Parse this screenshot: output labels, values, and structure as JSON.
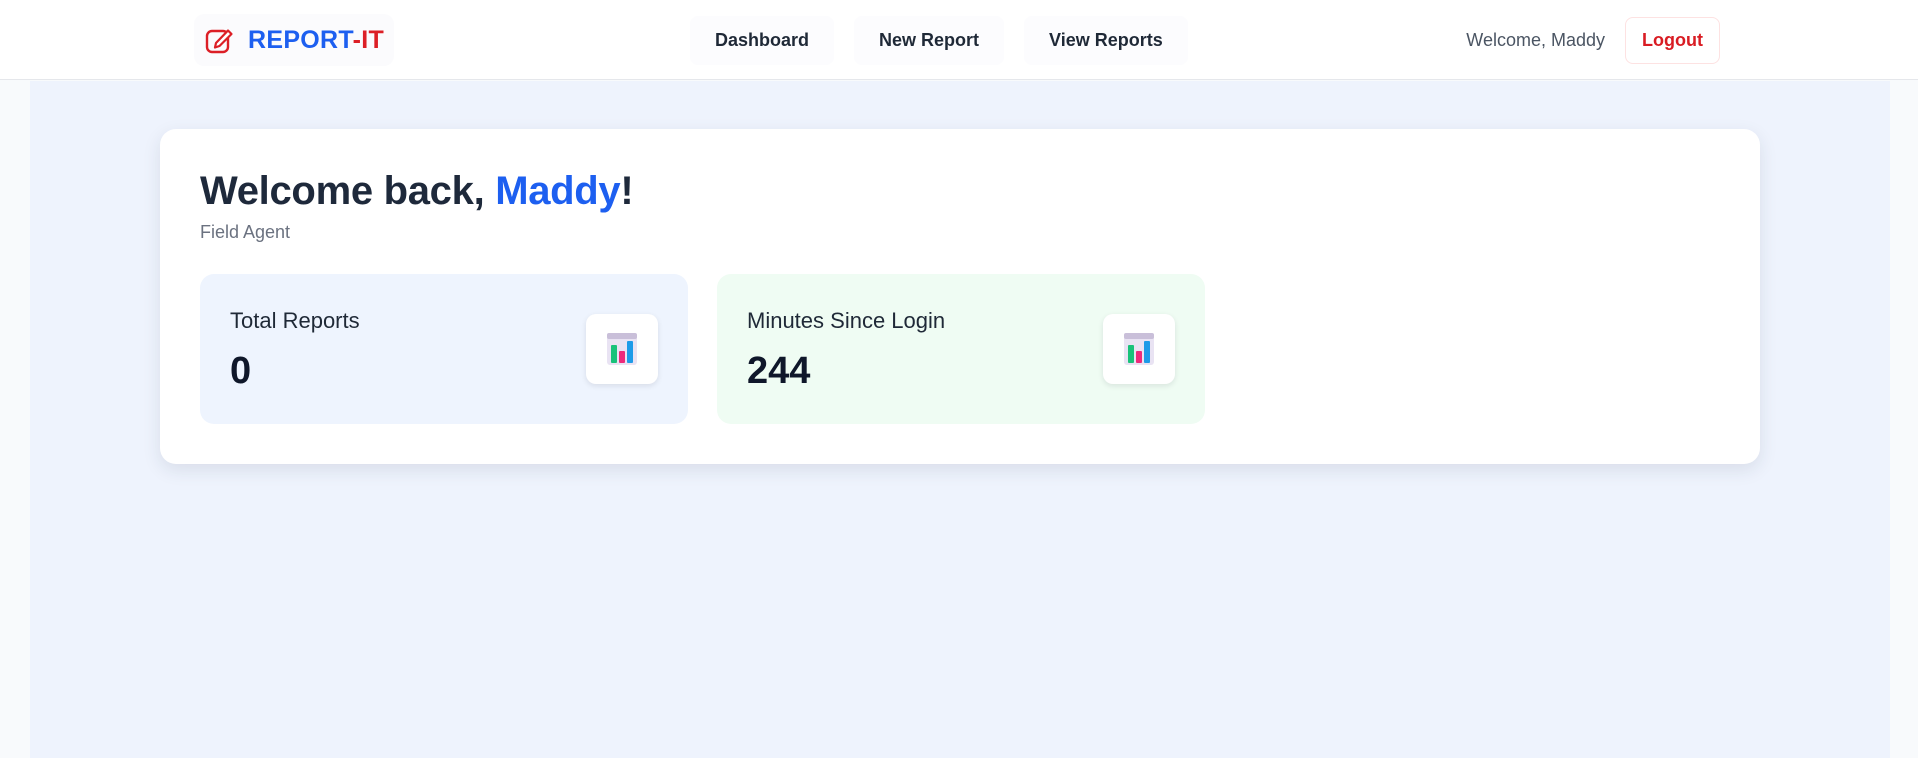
{
  "header": {
    "brand_part1": "REPORT",
    "brand_part2": "-IT",
    "nav": [
      {
        "label": "Dashboard"
      },
      {
        "label": "New Report"
      },
      {
        "label": "View Reports"
      }
    ],
    "welcome_text": "Welcome, Maddy",
    "logout_label": "Logout"
  },
  "main": {
    "greeting_prefix": "Welcome back, ",
    "user_name": "Maddy",
    "greeting_suffix": "!",
    "role": "Field Agent",
    "stats": [
      {
        "label": "Total Reports",
        "value": "0",
        "icon": "bar-chart-icon"
      },
      {
        "label": "Minutes Since Login",
        "value": "244",
        "icon": "bar-chart-icon"
      }
    ]
  },
  "colors": {
    "brand_blue": "#1d5ff0",
    "brand_red": "#dc1f26",
    "page_background": "#eef3fd",
    "stat_blue_bg": "#eef4fe",
    "stat_green_bg": "#effcf3"
  }
}
